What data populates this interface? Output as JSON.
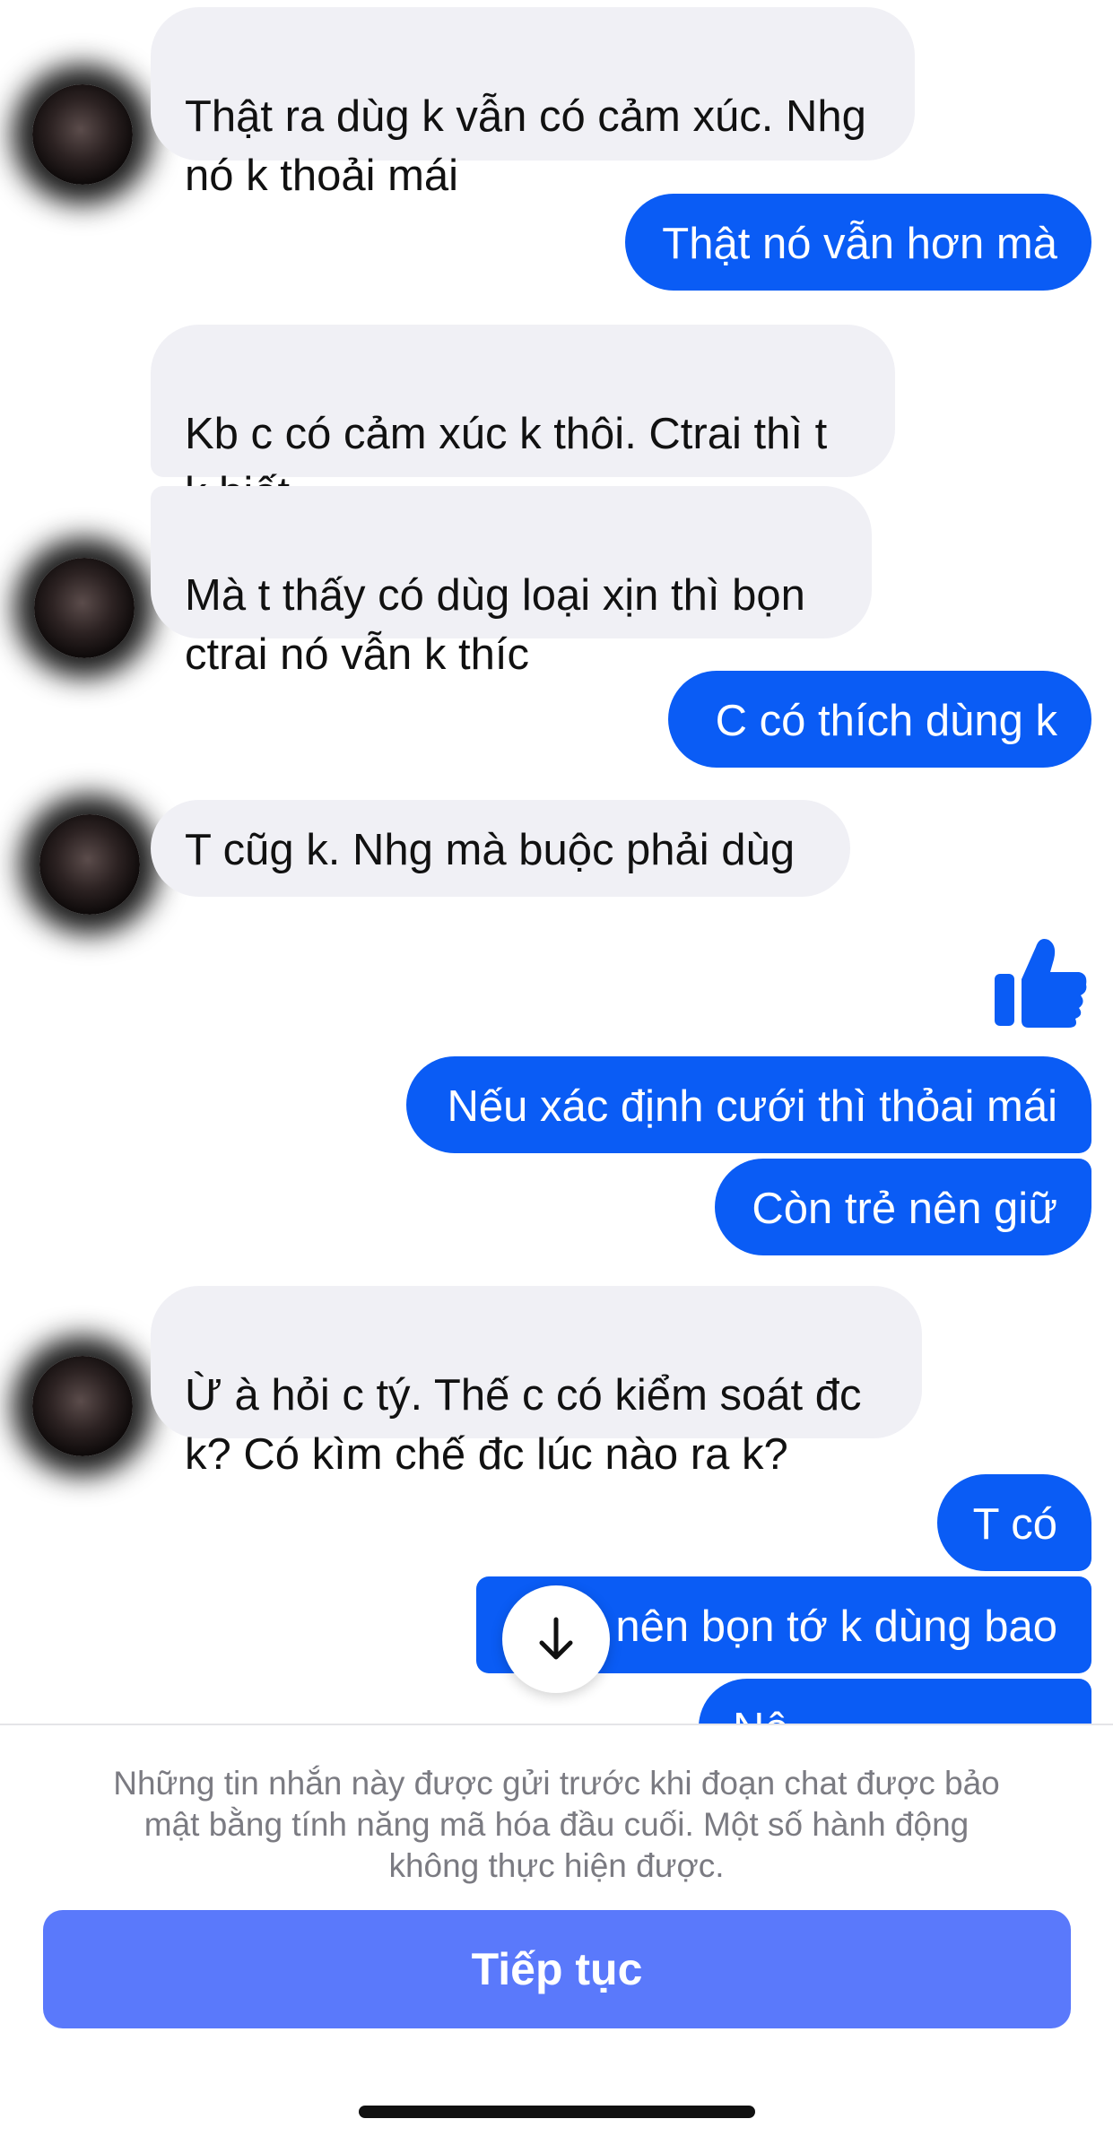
{
  "messages": [
    {
      "direction": "incoming",
      "text": "Thật ra dùg k vẫn có cảm xúc. Nhg\nnó k thoải mái"
    },
    {
      "direction": "outgoing",
      "text": "Thật nó vẫn hơn mà"
    },
    {
      "direction": "incoming",
      "text": "Kb c có cảm xúc k thôi. Ctrai thì t\nk biết"
    },
    {
      "direction": "incoming",
      "text": "Mà t thấy có dùg loại xịn thì bọn\nctrai nó vẫn k thíc"
    },
    {
      "direction": "outgoing",
      "text": "C có thích dùng k"
    },
    {
      "direction": "incoming",
      "text": "T cũg k. Nhg mà buộc phải dùg"
    },
    {
      "direction": "outgoing",
      "type": "like-reaction",
      "icon": "thumbs-up-icon"
    },
    {
      "direction": "outgoing",
      "text": "Nếu xác định cưới thì thỏai mái"
    },
    {
      "direction": "outgoing",
      "text": "Còn trẻ nên giữ"
    },
    {
      "direction": "incoming",
      "text": "Ừ à hỏi c tý. Thế c có kiểm soát đc\nk? Có kìm chế đc lúc nào ra k?"
    },
    {
      "direction": "outgoing",
      "text": "T có"
    },
    {
      "direction": "outgoing",
      "text": "nên bọn tớ k dùng bao"
    },
    {
      "direction": "outgoing",
      "text": "Nê"
    }
  ],
  "scroll_button": {
    "icon": "arrow-down-icon"
  },
  "footer": {
    "notice": "Những tin nhắn này được gửi trước khi đoạn chat được bảo\nmật bằng tính năng mã hóa đầu cuối. Một số hành động\nkhông thực hiện được.",
    "continue_label": "Tiếp tục"
  },
  "colors": {
    "incoming_bubble": "#f0f0f5",
    "outgoing_bubble": "#0a5cf5",
    "button": "#5a79fb",
    "notice_text": "#7b7b82"
  }
}
